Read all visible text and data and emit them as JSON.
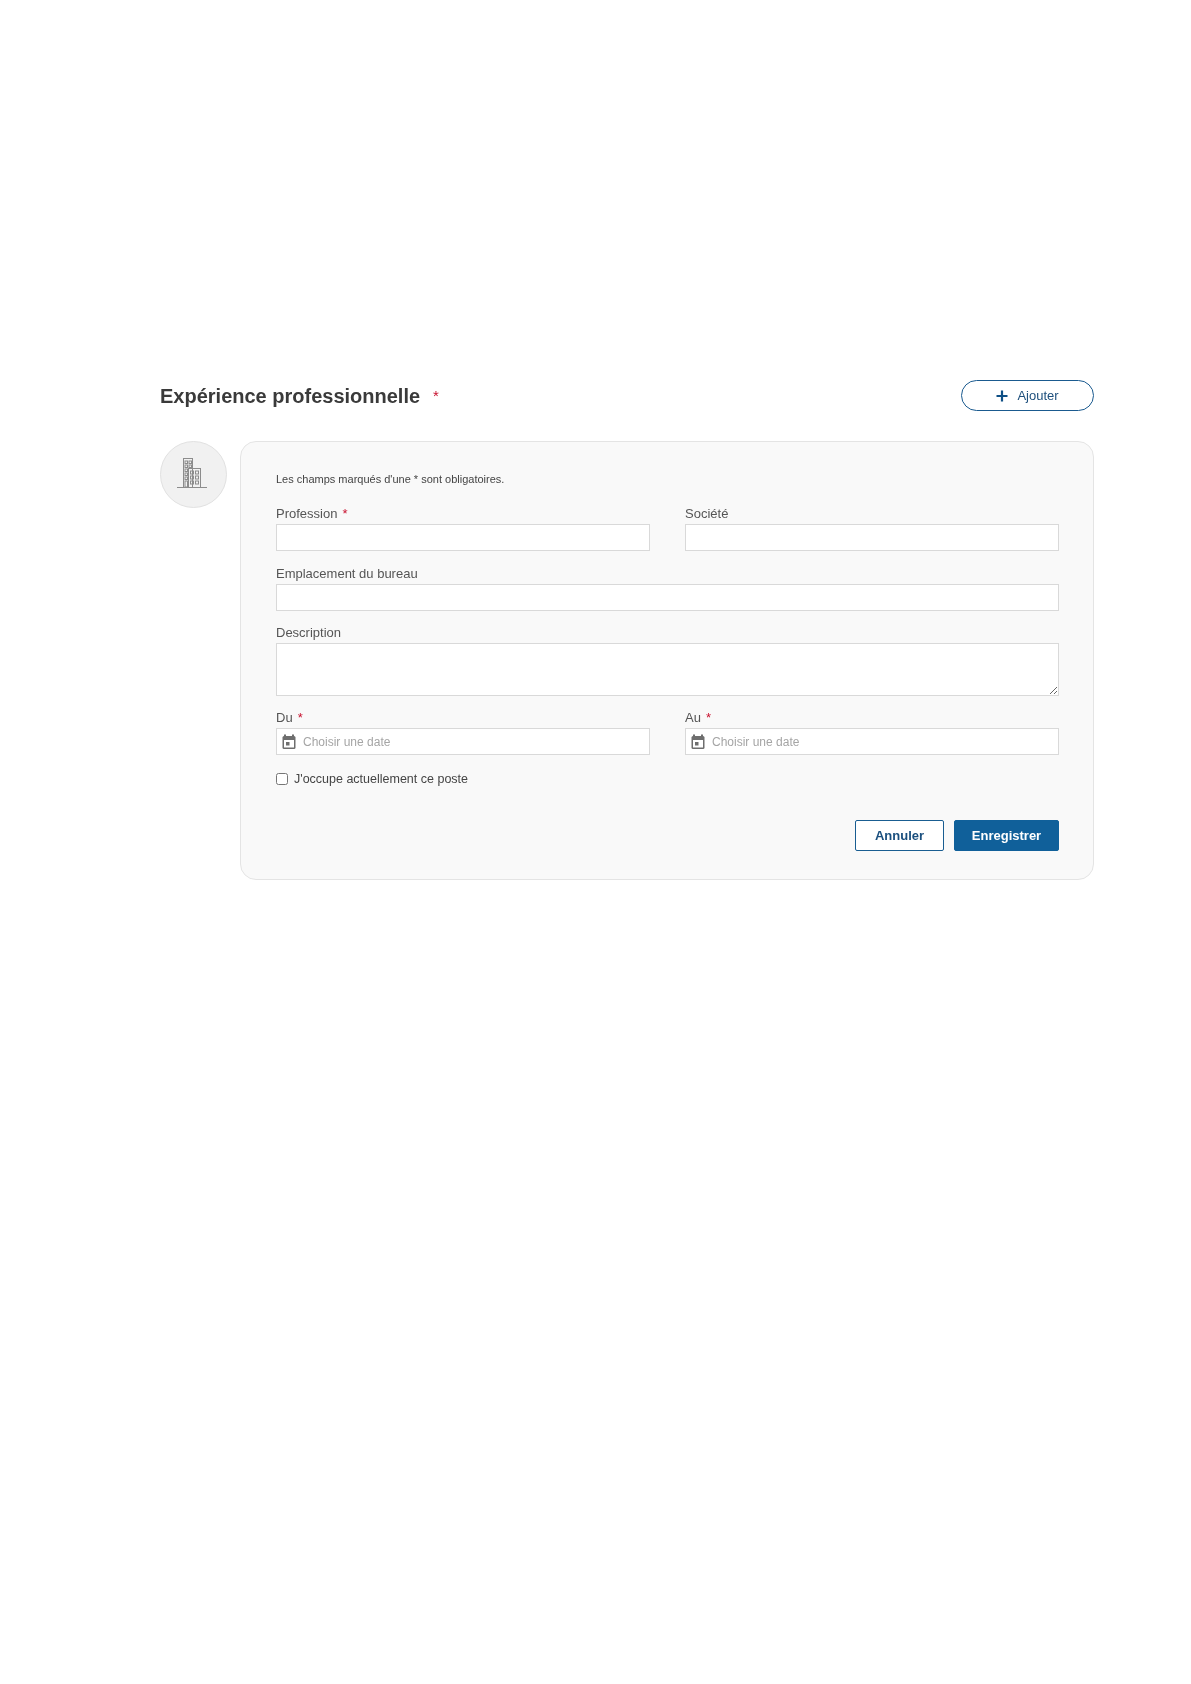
{
  "section": {
    "title": "Expérience professionnelle",
    "required_mark": "*",
    "add_button": {
      "label": "Ajouter"
    }
  },
  "form": {
    "note": "Les champs marqués d'une * sont obligatoires.",
    "rows": [
      {
        "fields": [
          {
            "kind": "text",
            "label": "Profession",
            "required_mark": "*"
          },
          {
            "kind": "text",
            "label": "Société"
          }
        ]
      },
      {
        "fields": [
          {
            "kind": "text",
            "label": "Emplacement du bureau"
          }
        ]
      },
      {
        "fields": [
          {
            "kind": "textarea",
            "label": "Description"
          }
        ]
      },
      {
        "fields": [
          {
            "kind": "date",
            "label": "Du",
            "required_mark": "*",
            "placeholder": "Choisir une date"
          },
          {
            "kind": "date",
            "label": "Au",
            "required_mark": "*",
            "placeholder": "Choisir une date"
          }
        ]
      }
    ],
    "checkbox": {
      "label": "J'occupe actuellement ce poste",
      "checked": false
    },
    "buttons": [
      {
        "kind": "secondary",
        "label": "Annuler"
      },
      {
        "kind": "primary",
        "label": "Enregistrer"
      }
    ]
  }
}
